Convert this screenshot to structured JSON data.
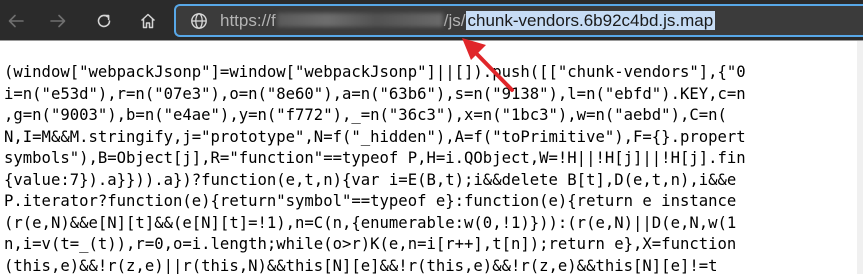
{
  "toolbar": {
    "back_icon": "arrow-left-icon",
    "forward_icon": "arrow-right-icon",
    "refresh_icon": "refresh-icon",
    "home_icon": "home-icon"
  },
  "address_bar": {
    "site_icon": "globe-icon",
    "url_scheme_host": "https://",
    "url_host_start": "f",
    "url_path": "/js/",
    "url_selected": "chunk-vendors.6b92c4bd.js.map",
    "selection_color": "#c6dcf5",
    "focus_color": "#58a8e8"
  },
  "annotation": {
    "arrow_color": "#e0262a"
  },
  "code": {
    "lines": [
      "(window[\"webpackJsonp\"]=window[\"webpackJsonp\"]||[]).push([[\"chunk-vendors\"],{\"0",
      "i=n(\"e53d\"),r=n(\"07e3\"),o=n(\"8e60\"),a=n(\"63b6\"),s=n(\"9138\"),l=n(\"ebfd\").KEY,c=n",
      ",g=n(\"9003\"),b=n(\"e4ae\"),y=n(\"f772\"),_=n(\"36c3\"),x=n(\"1bc3\"),w=n(\"aebd\"),C=n(",
      "N,I=M&&M.stringify,j=\"prototype\",N=f(\"_hidden\"),A=f(\"toPrimitive\"),F={}.propert",
      "symbols\"),B=Object[j],R=\"function\"==typeof P,H=i.QObject,W=!H||!H[j]||!H[j].fin",
      "{value:7}).a}})).a})?function(e,t,n){var i=E(B,t);i&&delete B[t],D(e,t,n),i&&e",
      "P.iterator?function(e){return\"symbol\"==typeof e}:function(e){return e instance",
      "(r(e,N)&&e[N][t]&&(e[N][t]=!1),n=C(n,{enumerable:w(0,!1)})):(r(e,N)||D(e,N,w(1",
      "n,i=v(t=_(t)),r=0,o=i.length;while(o>r)K(e,n=i[r++],t[n]);return e},X=function",
      "(this,e)&&!r(z,e)||r(this,N)&&this[N][e]&&!r(this,e)&&!r(z,e)&&this[N][e]!=t"
    ]
  }
}
